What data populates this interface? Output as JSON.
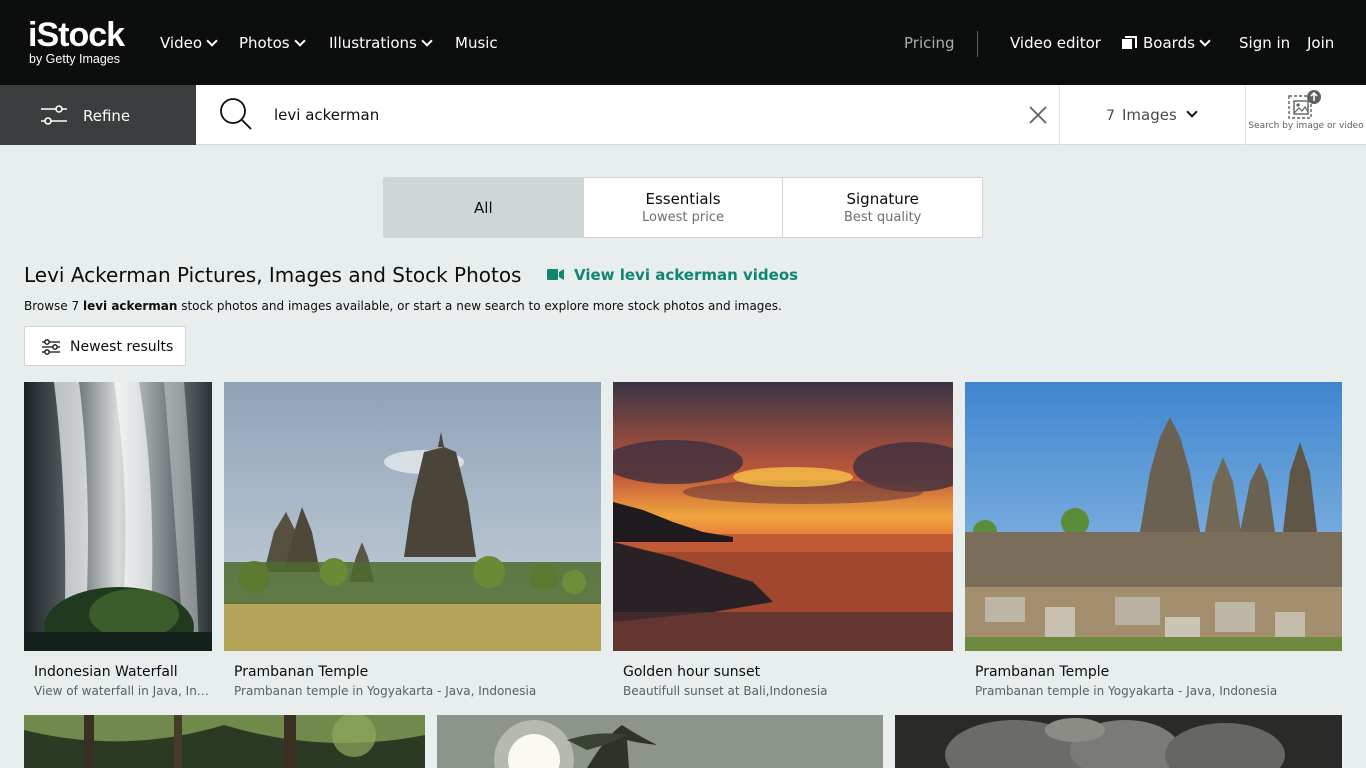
{
  "header": {
    "logo_main": "iStock",
    "logo_sub": "by Getty Images",
    "nav": [
      "Video",
      "Photos",
      "Illustrations",
      "Music"
    ],
    "pricing": "Pricing",
    "video_editor": "Video editor",
    "boards": "Boards",
    "sign_in": "Sign in",
    "join": "Join"
  },
  "search": {
    "refine_label": "Refine",
    "query": "levi ackerman",
    "type_count": "7",
    "type_label": "Images",
    "search_by_image": "Search by image or video"
  },
  "tabs": [
    {
      "title": "All",
      "subtitle": ""
    },
    {
      "title": "Essentials",
      "subtitle": "Lowest price"
    },
    {
      "title": "Signature",
      "subtitle": "Best quality"
    }
  ],
  "page": {
    "title": "Levi Ackerman Pictures, Images and Stock Photos",
    "video_link": "View levi ackerman videos",
    "browse_prefix": "Browse 7 ",
    "browse_term": "levi ackerman",
    "browse_suffix": " stock photos and images available, or start a new search to explore more stock photos and images.",
    "sort_label": "Newest results"
  },
  "results": [
    {
      "title": "Indonesian Waterfall",
      "description": "View of waterfall in Java, Ind..."
    },
    {
      "title": "Prambanan Temple",
      "description": "Prambanan temple in Yogyakarta - Java, Indonesia"
    },
    {
      "title": "Golden hour sunset",
      "description": "Beautifull sunset at Bali,Indonesia"
    },
    {
      "title": "Prambanan Temple",
      "description": "Prambanan temple in Yogyakarta - Java, Indonesia"
    }
  ],
  "colors": {
    "header_bg": "#0c0d0d",
    "page_bg": "#e8eded",
    "accent_green": "#0f8670",
    "refine_bg": "#3a3e3e"
  }
}
